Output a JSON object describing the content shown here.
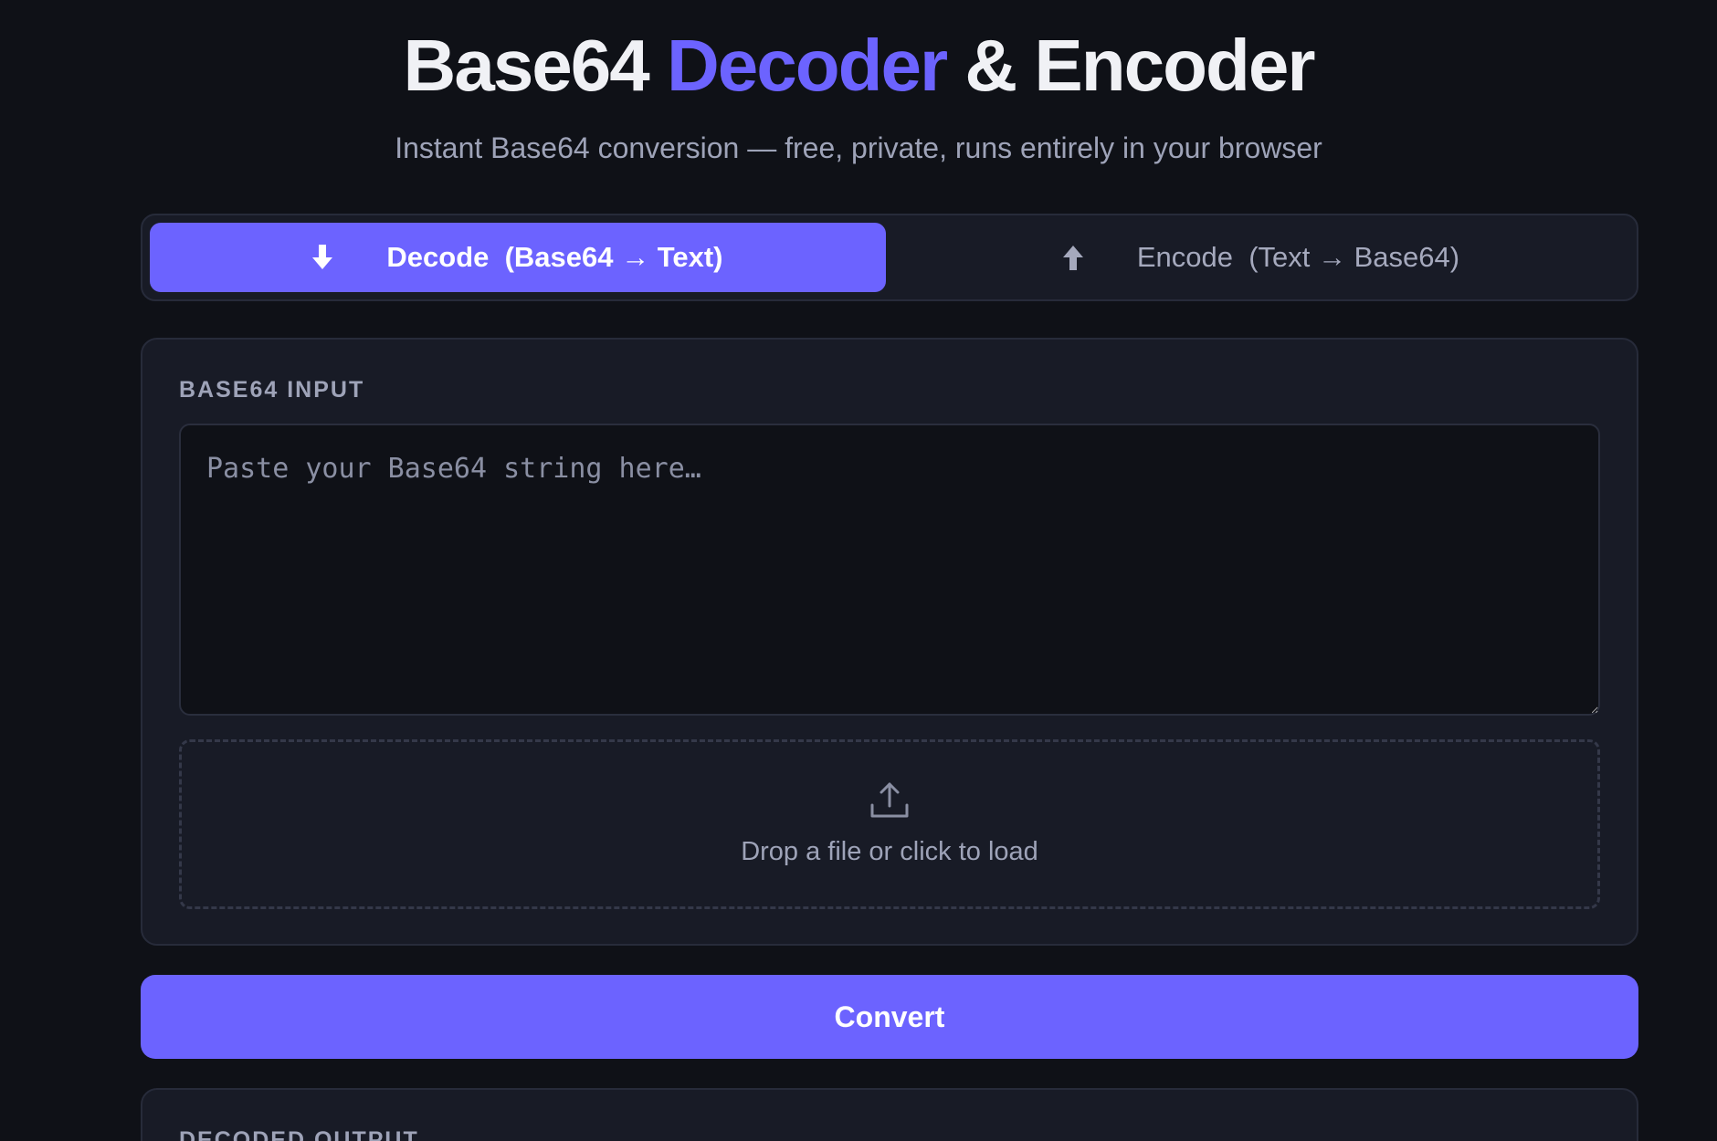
{
  "header": {
    "title_part1": "Base64 ",
    "title_accent": "Decoder",
    "title_part2": " & Encoder",
    "subtitle": "Instant Base64 conversion — free, private, runs entirely in your browser"
  },
  "mode_switch": {
    "decode_label": "Decode  (Base64 → Text)",
    "encode_label": "Encode  (Text → Base64)",
    "active": "decode"
  },
  "input": {
    "label": "BASE64 INPUT",
    "value": "",
    "placeholder": "Paste your Base64 string here…"
  },
  "dropzone": {
    "label": "Drop a file or click to load",
    "icon": "upload-icon"
  },
  "actions": {
    "convert_label": "Convert"
  },
  "output": {
    "label": "DECODED OUTPUT"
  },
  "colors": {
    "background": "#0f1117",
    "card": "#181b26",
    "accent": "#6c63ff",
    "muted_text": "#9ea3b8"
  }
}
